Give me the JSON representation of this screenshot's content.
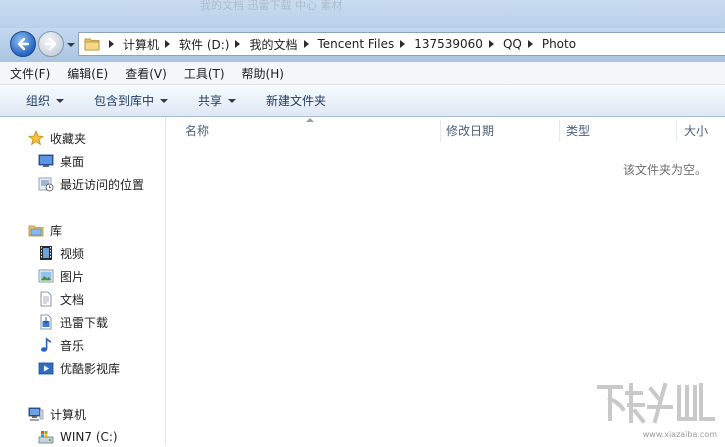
{
  "window": {
    "faded_title": "我的文档 迅雷下载 中心 素材"
  },
  "address": {
    "crumbs": [
      "计算机",
      "软件 (D:)",
      "我的文档",
      "Tencent Files",
      "137539060",
      "QQ",
      "Photo"
    ]
  },
  "menubar": {
    "items": [
      "文件(F)",
      "编辑(E)",
      "查看(V)",
      "工具(T)",
      "帮助(H)"
    ]
  },
  "toolbar": {
    "organize": "组织",
    "include_in_library": "包含到库中",
    "share": "共享",
    "new_folder": "新建文件夹"
  },
  "sidebar": {
    "favorites": "收藏夹",
    "desktop": "桌面",
    "recent": "最近访问的位置",
    "libraries": "库",
    "videos": "视频",
    "pictures": "图片",
    "documents": "文档",
    "thunder": "迅雷下载",
    "music": "音乐",
    "youku": "优酷影视库",
    "computer": "计算机",
    "drive_c": "WIN7 (C:)"
  },
  "columns": {
    "name": "名称",
    "date": "修改日期",
    "type": "类型",
    "size": "大小"
  },
  "empty_message": "该文件夹为空。",
  "watermark": {
    "url": "www.xiazaiba.com"
  },
  "colors": {
    "accent": "#2d6bc4",
    "chrome": "#b9d1ea",
    "toolbar_text": "#1e3a5e"
  }
}
